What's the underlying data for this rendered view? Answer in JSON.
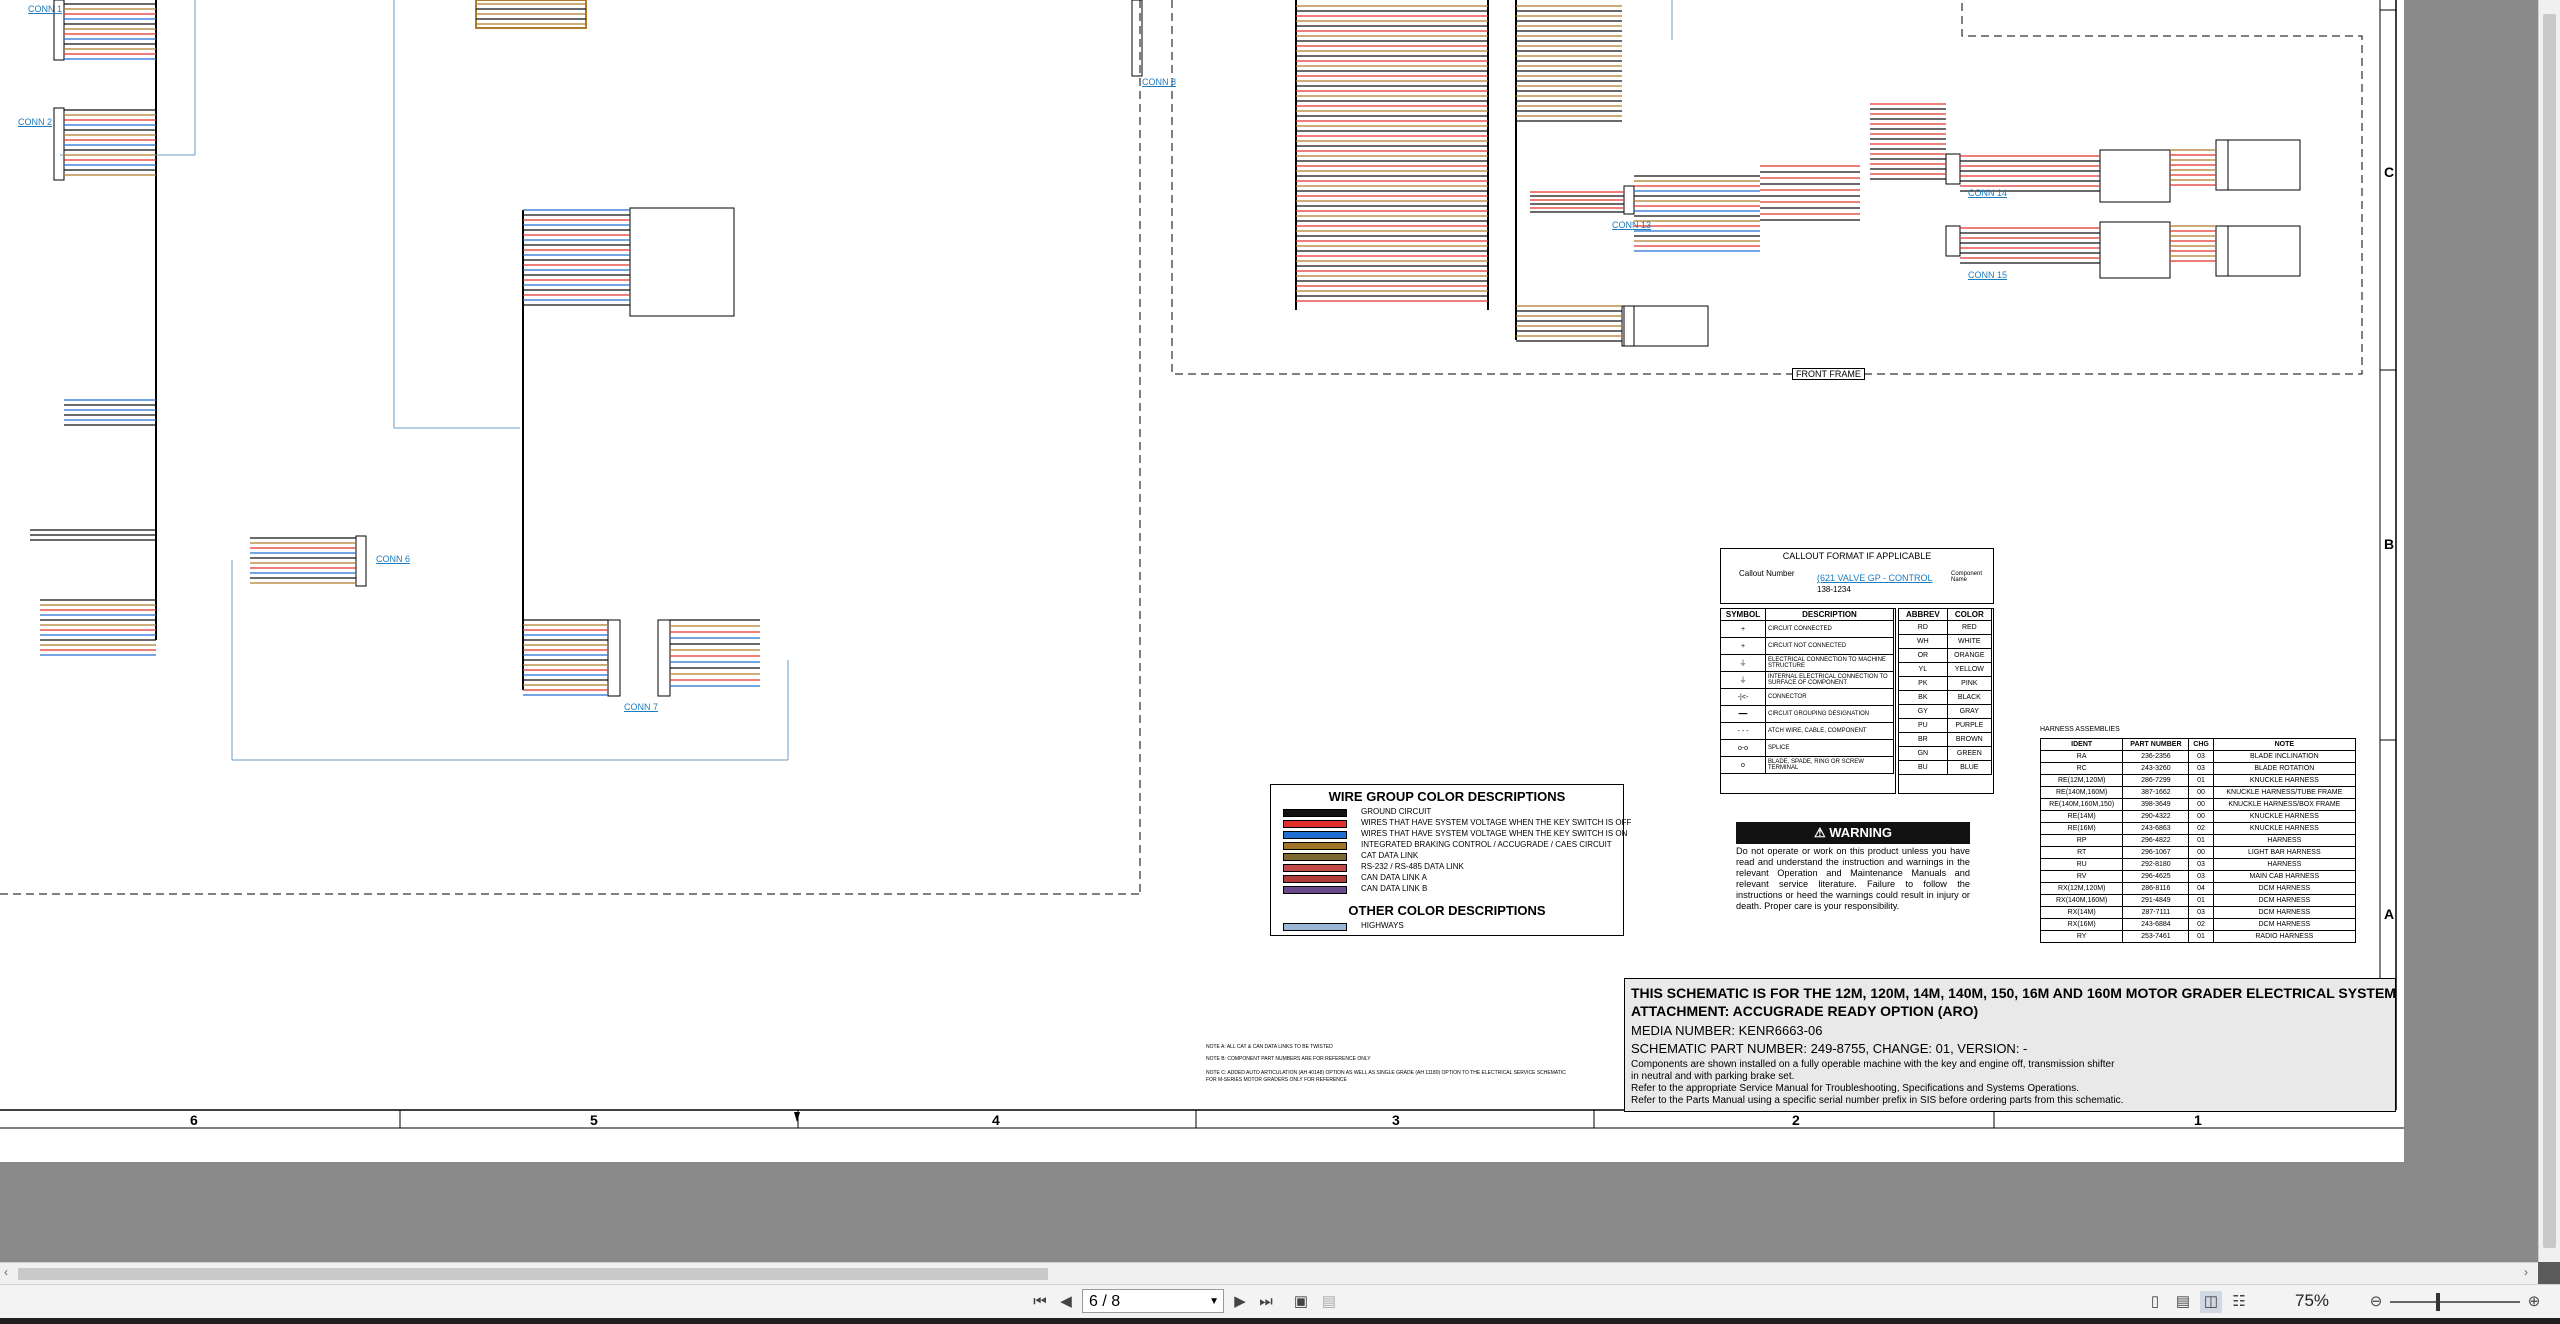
{
  "connectors": {
    "conn1": "CONN 1",
    "conn2": "CONN 2",
    "conn6": "CONN 6",
    "conn7": "CONN 7",
    "conn8": "CONN 8",
    "conn13": "CONN 13",
    "conn14": "CONN 14",
    "conn15": "CONN 15"
  },
  "front_frame": "FRONT FRAME",
  "callout": {
    "title": "CALLOUT FORMAT IF APPLICABLE",
    "callout_number": "Callout Number",
    "part": "138-1234",
    "link": "(621 VALVE GP - CONTROL",
    "component_name": "Component Name"
  },
  "symbols": {
    "header_symbol": "SYMBOL",
    "header_description": "DESCRIPTION",
    "rows": [
      {
        "symbol": "+",
        "description": "CIRCUIT CONNECTED"
      },
      {
        "symbol": "+",
        "description": "CIRCUIT NOT CONNECTED"
      },
      {
        "symbol": "⏚",
        "description": "ELECTRICAL CONNECTION TO MACHINE STRUCTURE"
      },
      {
        "symbol": "⏚",
        "description": "INTERNAL ELECTRICAL CONNECTION TO SURFACE OF COMPONENT"
      },
      {
        "symbol": "-|<-",
        "description": "CONNECTOR"
      },
      {
        "symbol": "━━",
        "description": "CIRCUIT GROUPING DESIGNATION"
      },
      {
        "symbol": "- - -",
        "description": "ATCH WIRE, CABLE, COMPONENT"
      },
      {
        "symbol": "o-o",
        "description": "SPLICE"
      },
      {
        "symbol": "o",
        "description": "BLADE, SPADE, RING OR SCREW TERMINAL"
      }
    ]
  },
  "colors": {
    "header_abbrev": "ABBREV",
    "header_color": "COLOR",
    "rows": [
      {
        "abbrev": "RD",
        "color": "RED"
      },
      {
        "abbrev": "WH",
        "color": "WHITE"
      },
      {
        "abbrev": "OR",
        "color": "ORANGE"
      },
      {
        "abbrev": "YL",
        "color": "YELLOW"
      },
      {
        "abbrev": "PK",
        "color": "PINK"
      },
      {
        "abbrev": "BK",
        "color": "BLACK"
      },
      {
        "abbrev": "GY",
        "color": "GRAY"
      },
      {
        "abbrev": "PU",
        "color": "PURPLE"
      },
      {
        "abbrev": "BR",
        "color": "BROWN"
      },
      {
        "abbrev": "GN",
        "color": "GREEN"
      },
      {
        "abbrev": "BU",
        "color": "BLUE"
      }
    ]
  },
  "wire_group": {
    "title": "WIRE GROUP COLOR DESCRIPTIONS",
    "rows": [
      {
        "label": "GROUND CIRCUIT",
        "swatch": "#111111"
      },
      {
        "label": "WIRES THAT HAVE SYSTEM VOLTAGE WHEN THE KEY SWITCH IS OFF",
        "swatch": "#e0302c"
      },
      {
        "label": "WIRES THAT HAVE SYSTEM VOLTAGE WHEN THE KEY SWITCH IS ON",
        "swatch": "#1f6fd1"
      },
      {
        "label": "INTEGRATED BRAKING CONTROL / ACCUGRADE / CAES CIRCUIT",
        "swatch": "#a0722a"
      },
      {
        "label": "CAT DATA LINK",
        "swatch": "#7d6a33"
      },
      {
        "label": "RS-232 / RS-485 DATA LINK",
        "swatch": "#c24a4a"
      },
      {
        "label": "CAN DATA LINK A",
        "swatch": "#b03b3b"
      },
      {
        "label": "CAN DATA LINK B",
        "swatch": "#6a4a8a"
      }
    ],
    "other_title": "OTHER COLOR DESCRIPTIONS",
    "other_rows": [
      {
        "label": "HIGHWAYS",
        "swatch": "#9ab8d6"
      }
    ]
  },
  "warning": {
    "title": "WARNING",
    "text": "Do not operate or work on this product unless you have read and understand the instruction and warnings in the relevant Operation and Maintenance Manuals and relevant service literature. Failure to follow the instructions or heed the warnings could result in injury or death. Proper care is your responsibility."
  },
  "harness": {
    "title": "HARNESS ASSEMBLIES",
    "headers": [
      "IDENT",
      "PART NUMBER",
      "CHG",
      "NOTE"
    ],
    "rows": [
      [
        "RA",
        "236-2356",
        "03",
        "BLADE INCLINATION"
      ],
      [
        "RC",
        "243-3260",
        "03",
        "BLADE ROTATION"
      ],
      [
        "RE(12M,120M)",
        "286-7299",
        "01",
        "KNUCKLE HARNESS"
      ],
      [
        "RE(140M,160M)",
        "387-1662",
        "00",
        "KNUCKLE HARNESS/TUBE FRAME"
      ],
      [
        "RE(140M,160M,150)",
        "398-3649",
        "00",
        "KNUCKLE HARNESS/BOX FRAME"
      ],
      [
        "RE(14M)",
        "290-4322",
        "00",
        "KNUCKLE HARNESS"
      ],
      [
        "RE(16M)",
        "243-6863",
        "02",
        "KNUCKLE HARNESS"
      ],
      [
        "RP",
        "296-4822",
        "01",
        "HARNESS"
      ],
      [
        "RT",
        "296-1067",
        "00",
        "LIGHT BAR HARNESS"
      ],
      [
        "RU",
        "292-8180",
        "03",
        "HARNESS"
      ],
      [
        "RV",
        "296-4625",
        "03",
        "MAIN CAB HARNESS"
      ],
      [
        "RX(12M,120M)",
        "286-8116",
        "04",
        "DCM HARNESS"
      ],
      [
        "RX(140M,160M)",
        "291-4849",
        "01",
        "DCM HARNESS"
      ],
      [
        "RX(14M)",
        "287-7111",
        "03",
        "DCM HARNESS"
      ],
      [
        "RX(16M)",
        "243-6884",
        "02",
        "DCM HARNESS"
      ],
      [
        "RY",
        "253-7461",
        "01",
        "RADIO HARNESS"
      ]
    ]
  },
  "notes": {
    "a": "NOTE A: ALL CAT & CAN DATA LINKS TO BE TWISTED",
    "b": "NOTE B: COMPONENT PART NUMBERS ARE FOR REFERENCE ONLY",
    "c1": "NOTE C: ADDED AUTO ARTICULATION (AH 40148) OPTION AS WELL AS SINGLE GRADE (AH 11180) OPTION TO THE ELECTRICAL SERVICE SCHEMATIC",
    "c2": "FOR M-SERIES MOTOR GRADERS ONLY FOR REFERENCE"
  },
  "title_block": {
    "line1": "THIS SCHEMATIC IS FOR THE 12M, 120M, 14M, 140M, 150, 16M AND 160M MOTOR GRADER ELECTRICAL SYSTEM",
    "line2": "ATTACHMENT: ACCUGRADE READY OPTION (ARO)",
    "line3": "MEDIA NUMBER: KENR6663-06",
    "line4": "SCHEMATIC PART NUMBER: 249-8755, CHANGE: 01, VERSION: -",
    "line5": "Components are shown installed on a fully operable machine with the key and engine off, transmission shifter",
    "line6": "in neutral and with parking brake set.",
    "line7": "Refer to the appropriate Service Manual for Troubleshooting, Specifications and Systems Operations.",
    "line8": "Refer to the Parts Manual using a specific serial number prefix in SIS before ordering parts from this schematic."
  },
  "grid_columns": [
    "6",
    "5",
    "4",
    "3",
    "2",
    "1"
  ],
  "grid_rows": [
    "C",
    "B",
    "A"
  ],
  "toolbar": {
    "page_value": "6 / 8",
    "zoom": "75%"
  }
}
